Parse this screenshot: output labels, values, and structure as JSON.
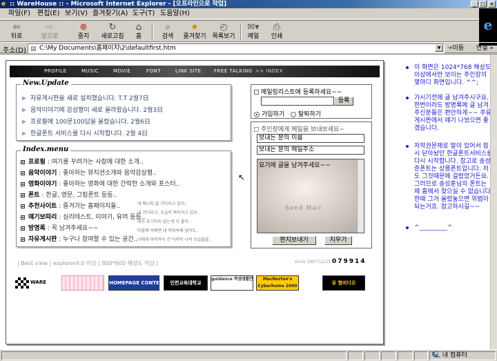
{
  "window": {
    "title": ":: WareHouse :: - Microsoft Internet Explorer - [오프라인으로 작업]",
    "controls": [
      "minimize",
      "maximize",
      "close"
    ]
  },
  "menubar": {
    "items": [
      "파일(F)",
      "편집(E)",
      "보기(V)",
      "즐겨찾기(A)",
      "도구(T)",
      "도움말(H)"
    ]
  },
  "toolbar": {
    "buttons": [
      {
        "label": "뒤로",
        "icon": "back-arrow-icon"
      },
      {
        "label": "앞으로",
        "icon": "forward-arrow-icon"
      },
      {
        "label": "중지",
        "icon": "stop-icon"
      },
      {
        "label": "새로고침",
        "icon": "refresh-icon"
      },
      {
        "label": "홈",
        "icon": "home-icon"
      },
      {
        "label": "검색",
        "icon": "search-icon"
      },
      {
        "label": "즐겨찾기",
        "icon": "favorites-icon"
      },
      {
        "label": "목록보기",
        "icon": "history-icon"
      },
      {
        "label": "메일",
        "icon": "mail-icon"
      },
      {
        "label": "인쇄",
        "icon": "print-icon"
      }
    ]
  },
  "addressbar": {
    "label": "주소(D)",
    "value": "C:\\My Documents\\홈페이지\\2\\defaultfirst.htm",
    "go": "이동",
    "links": "연결 »"
  },
  "site": {
    "nav": [
      "PROFILE",
      "MUSIC",
      "MOVIE",
      "FONT",
      "LINK SITE",
      "FREE TALKING",
      ">> INDEX"
    ],
    "news": {
      "title": "New.Update",
      "items": [
        "자유게시판을 새로 설치했습니다. T.T 2월7日",
        "음악이야기에 감상평이 새로 올라왔습니다. 2월3日",
        "프로필에 100문100답을 올렸습니다. 2월6日",
        "한글폰트 서비스를 다시 시작합니다. 2월 4日"
      ]
    },
    "index_menu": {
      "title": "Index.menu",
      "items": [
        {
          "name": "프로필",
          "desc": "여기를 꾸려가는 사람에 대한 소개.."
        },
        {
          "name": "음악이야기",
          "desc": "좋아하는 뮤지션소개와 음악감상평.."
        },
        {
          "name": "영화이야기",
          "desc": "좋아하는 영화에 대한 간략한 소개와 포스터.."
        },
        {
          "name": "폰트",
          "desc": "한글, 영문, 그림폰트 등등.."
        },
        {
          "name": "추천사이트",
          "desc": "즐겨가는 홈페이지들.."
        },
        {
          "name": "얘기보따리",
          "desc": "심리테스트, 이야기, 유머 등등.."
        },
        {
          "name": "방명록",
          "desc": "꼭 남겨주세요~~"
        },
        {
          "name": "자유게시판",
          "desc": "누구나 참여할 수 있는 공간.."
        }
      ]
    },
    "mailing": {
      "title": "메일링리스트에 등록하세요~~",
      "button": "등록",
      "options": [
        "가입하기",
        "탈퇴하기"
      ]
    },
    "send_mail": {
      "title": "주인장에게 메일을 보내보세요~",
      "name_placeholder": "보내는 분의 이름",
      "email_placeholder": "보내는 분의 메일주소",
      "message": "요기에 글을 남겨주세요~~",
      "image_caption": "Send Mail",
      "send_button": "편지보내기",
      "clear_button": "지우기"
    },
    "footer": {
      "note": "| Best view | explorer4.0 이상 | 800*600 해상도 이상 |",
      "since": "since 1997/12/25",
      "counter": "079914"
    },
    "banners": [
      {
        "label": "WARE",
        "color": "#000000"
      },
      {
        "label": "",
        "color": "#ffd0e0"
      },
      {
        "label": "HOMEPAGE CONTEST",
        "color": "#1f3f9f"
      },
      {
        "label": "인천교육대학교",
        "color": "#000000"
      },
      {
        "label": "guidance 학생생활연구소",
        "color": "#ffffff"
      },
      {
        "label": "MacNorton's Cyberhome 2000",
        "color": "#ffcc00"
      },
      {
        "label": "유 형비디오",
        "color": "#000000"
      }
    ],
    "faint_lines": [
      "내 메시지 쓸 기다리고 있어..",
      "내 기다리고, 조금씩 쪽어가고 있어..",
      "내가 포기하지 않는게 더 좋아..",
      "마을에 어쩌면 내 머릿속에 남아도..",
      "너에게 마지막이 건 이지막 나의 모습들을.."
    ]
  },
  "right_notes": [
    "이 화면은 1024*768 해상도 이상에서만 보이는 주인장의 몇마디 화면입니다. ^^;",
    "가시기전에 글 남겨주시구요. 한번이라도 방명록에 글 남겨주신분들은 편안하게~~ 주유게시판에서 얘기 나눴으면 좋겠습니다.",
    "저작권문제로 말이 있어서 잠시 닫아놨던 한글폰트서비스를 다시 시작합니다. 참고로 송성준폰트는 상용폰트입니다. 저도 그것때문에 걸렸었거든요. 그러므로 송성훈님의 폰트는 제 홈에서 찾으실 수 없습니다. 한때 그거 올렸놓으면 위법이 되는거죠. 참고하시길~~",
    "^_________^"
  ],
  "statusbar": {
    "zone": "내 컴퓨터"
  }
}
